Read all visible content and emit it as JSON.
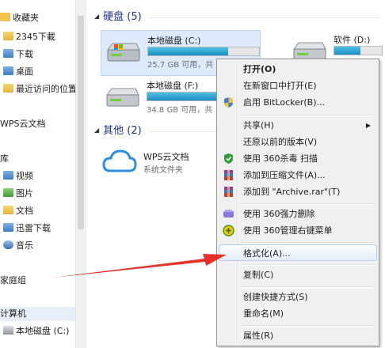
{
  "nav": {
    "favorites": "收藏夹",
    "fav_items": [
      "2345下載",
      "下载",
      "桌面",
      "最近访问的位置"
    ],
    "wps": "WPS云文档",
    "libraries": "库",
    "lib_items": [
      "视频",
      "图片",
      "文档",
      "迅雷下载",
      "音乐"
    ],
    "homegroup": "家庭组",
    "computer": "计算机",
    "local_disk": "本地磁盘 (C:)"
  },
  "main": {
    "hard_disks_header": "硬盘 (5)",
    "other_header": "其他 (2)",
    "drives": [
      {
        "name": "本地磁盘 (C:)",
        "free": "25.7 GB 可用，共",
        "fill": 0.72
      },
      {
        "name": "软件 (D:)",
        "free": "",
        "fill": 0.55
      },
      {
        "name": "本地磁盘 (F:)",
        "free": "34.8 GB 可用，共",
        "fill": 0.8
      }
    ],
    "wps_item": {
      "name": "WPS云文档",
      "type": "系统文件夹"
    }
  },
  "menu": {
    "items": [
      "打开(O)",
      "在新窗口中打开(E)",
      "启用 BitLocker(B)...",
      "共享(H)",
      "还原以前的版本(V)",
      "使用 360杀毒 扫描",
      "添加到压缩文件(A)...",
      "添加到 \"Archive.rar\"(T)",
      "使用 360强力删除",
      "使用 360管理右键菜单",
      "格式化(A)...",
      "复制(C)",
      "创建快捷方式(S)",
      "重命名(M)",
      "属性(R)"
    ]
  },
  "colors": {
    "accent": "#1e3287",
    "bar": "#1d8fc2",
    "arrow": "#e8302a"
  }
}
